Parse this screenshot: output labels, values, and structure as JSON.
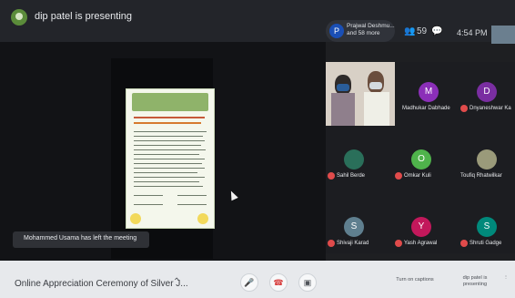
{
  "presenter": {
    "label": "dip patel is presenting"
  },
  "people_chip": {
    "initial": "P",
    "text": "Prajwal Deshmu... and 58 more"
  },
  "top_icons": {
    "people_count": "59",
    "clock": "4:54 PM"
  },
  "toast": {
    "text": "Mohammed Usama has left the meeting"
  },
  "grid": {
    "tiles": [
      {
        "name": "Madhukar Dabhade",
        "initial": "M",
        "color": "#8b2fb8",
        "muted": false
      },
      {
        "name": "Dnyaneshwar Ka",
        "initial": "D",
        "color": "#7a2ea1",
        "muted": true
      },
      {
        "name": "Sahil Berde",
        "initial": "",
        "color": "#2a6f5a",
        "muted": true
      },
      {
        "name": "Omkar Kuli",
        "initial": "O",
        "color": "#4fb34b",
        "muted": true
      },
      {
        "name": "Toufiq Rhatwilkar",
        "initial": "",
        "color": "#9a9a7a",
        "muted": false
      },
      {
        "name": "Shivaji Karad",
        "initial": "S",
        "color": "#5f7f8f",
        "muted": true
      },
      {
        "name": "Yash Agrawal",
        "initial": "Y",
        "color": "#c2185b",
        "muted": true
      },
      {
        "name": "Shruti Gadge",
        "initial": "S",
        "color": "#00897b",
        "muted": true
      }
    ]
  },
  "bottom": {
    "meeting_title": "Online Appreciation Ceremony of Silver J...",
    "captions_label": "Turn on captions",
    "presenting_label": "dip patel is presenting"
  }
}
